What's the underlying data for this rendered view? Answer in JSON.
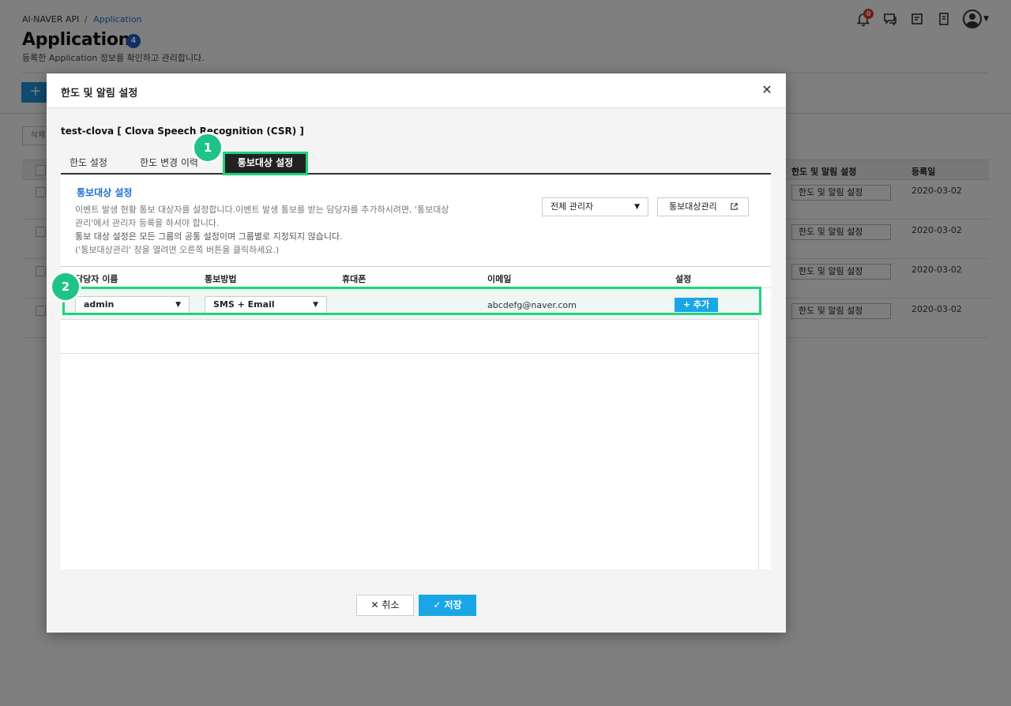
{
  "page": {
    "breadcrumb": {
      "root": "AI·NAVER API",
      "separator": "/",
      "current": "Application"
    },
    "title": "Application",
    "count_badge": "4",
    "description": "등록한 Application 정보를 확인하고 관리합니다.",
    "notification_count": "0",
    "add_label": "+",
    "delete_label": "삭제",
    "table": {
      "headers": {
        "limit": "한도 및 알림 설정",
        "date": "등록일"
      },
      "rows": [
        {
          "limit_button": "한도 및 알림 설정",
          "date": "2020-03-02"
        },
        {
          "limit_button": "한도 및 알림 설정",
          "date": "2020-03-02"
        },
        {
          "limit_button": "한도 및 알림 설정",
          "date": "2020-03-02"
        },
        {
          "limit_button": "한도 및 알림 설정",
          "date": "2020-03-02"
        }
      ]
    }
  },
  "modal": {
    "title": "한도 및 알림 설정",
    "close_icon": "close-icon",
    "product_name": "test-clova [ Clova Speech Recognition (CSR) ]",
    "tabs": [
      {
        "label": "한도 설정",
        "active": false
      },
      {
        "label": "한도 변경 이력",
        "active": false
      },
      {
        "label": "통보대상 설정",
        "active": true
      }
    ],
    "steps": {
      "one": "1",
      "two": "2"
    },
    "section_title": "통보대상 설정",
    "description_lines": [
      "이벤트 발생 현황 통보 대상자를 설정합니다.이벤트 발생 통보를 받는 담당자를 추가하시려면, '통보대상",
      "관리'에서 관리자 등록을 하셔야 합니다.",
      "통보 대상 설정은 모든 그룹의 공통 설정이며 그룹별로 지정되지 않습니다.",
      "('통보대상관리' 창을 열려면 오른쪽 버튼을 클릭하세요.)"
    ],
    "filter_select": "전체 관리자",
    "manage_button": "통보대상관리",
    "grid": {
      "headers": [
        "담당자 이름",
        "통보방법",
        "휴대폰",
        "이메일",
        "설정"
      ],
      "row": {
        "name": "admin",
        "method": "SMS + Email",
        "phone": "",
        "email": "abcdefg@naver.com",
        "add_button": "+ 추가"
      }
    },
    "cancel_button": "취소",
    "save_button": "저장"
  },
  "colors": {
    "accent": "#1aa6e6",
    "highlight": "#1dd47a",
    "step_badge": "#1ec387",
    "link": "#1e6ed6"
  }
}
